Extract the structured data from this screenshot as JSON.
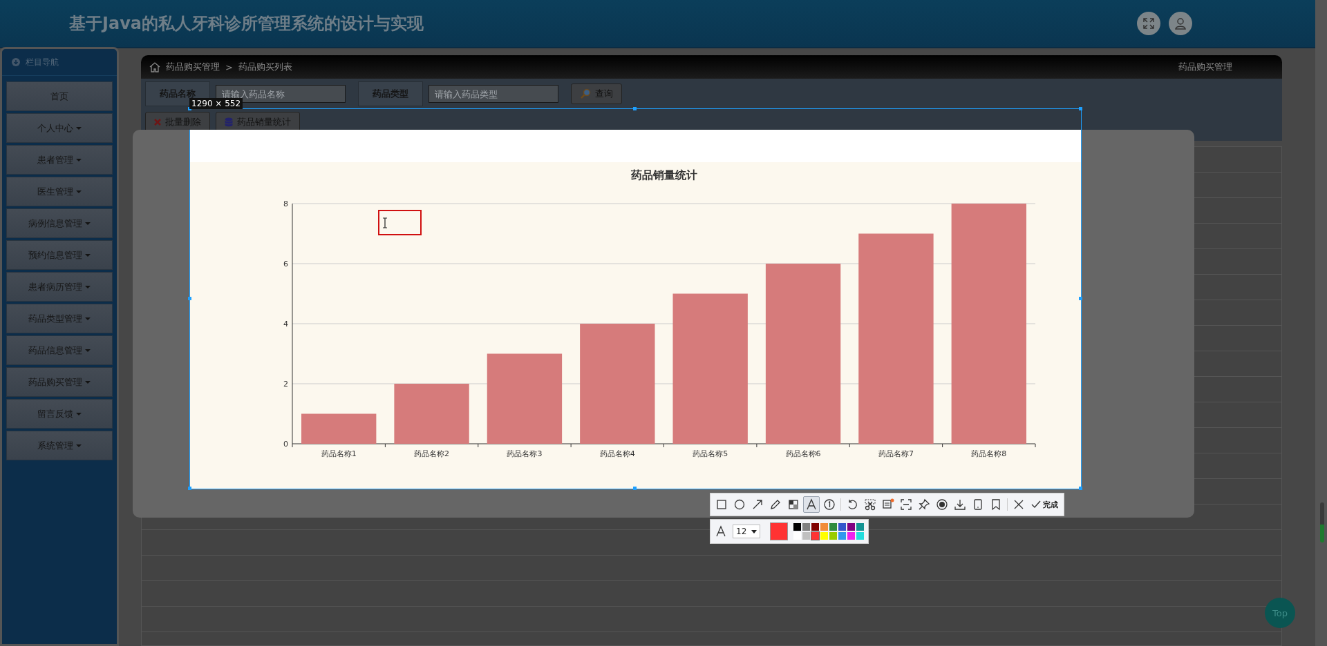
{
  "header": {
    "title": "基于Java的私人牙科诊所管理系统的设计与实现"
  },
  "sidebar": {
    "title": "栏目导航",
    "items": [
      {
        "label": "首页",
        "has_menu": false
      },
      {
        "label": "个人中心",
        "has_menu": true
      },
      {
        "label": "患者管理",
        "has_menu": true
      },
      {
        "label": "医生管理",
        "has_menu": true
      },
      {
        "label": "病例信息管理",
        "has_menu": true
      },
      {
        "label": "预约信息管理",
        "has_menu": true
      },
      {
        "label": "患者病历管理",
        "has_menu": true
      },
      {
        "label": "药品类型管理",
        "has_menu": true
      },
      {
        "label": "药品信息管理",
        "has_menu": true
      },
      {
        "label": "药品购买管理",
        "has_menu": true
      },
      {
        "label": "留言反馈",
        "has_menu": true
      },
      {
        "label": "系统管理",
        "has_menu": true
      }
    ]
  },
  "breadcrumb": {
    "items": [
      "药品购买管理",
      "药品购买列表"
    ],
    "separator": ">",
    "page_title": "药品购买管理"
  },
  "search": {
    "fields": [
      {
        "label": "药品名称",
        "placeholder": "请输入药品名称"
      },
      {
        "label": "药品类型",
        "placeholder": "请输入药品类型"
      }
    ],
    "button": "查询"
  },
  "actions": [
    {
      "kind": "delete",
      "label": "批量删除"
    },
    {
      "kind": "stats",
      "label": "药品销量统计"
    }
  ],
  "capture": {
    "size": "1290 × 552",
    "chart_data": {
      "type": "bar",
      "title": "药品销量统计",
      "categories": [
        "药品名称1",
        "药品名称2",
        "药品名称3",
        "药品名称4",
        "药品名称5",
        "药品名称6",
        "药品名称7",
        "药品名称8"
      ],
      "series": [
        {
          "color": "#d67b7b",
          "values": [
            1,
            2,
            3,
            4,
            5,
            6,
            7,
            8
          ]
        }
      ],
      "ylim": [
        0,
        8
      ],
      "yticks": [
        0,
        2,
        4,
        6,
        8
      ],
      "grid": true
    }
  },
  "capture_toolbar": {
    "tool_groups": [
      {
        "tools": [
          {
            "kind": "rectangle",
            "selected": false
          },
          {
            "kind": "ellipse",
            "selected": false
          },
          {
            "kind": "arrow",
            "selected": false
          },
          {
            "kind": "pencil",
            "selected": false
          },
          {
            "kind": "mosaic",
            "selected": false
          },
          {
            "kind": "text",
            "selected": true
          },
          {
            "kind": "number",
            "selected": false
          }
        ]
      },
      {
        "tools": [
          {
            "kind": "undo",
            "selected": false
          },
          {
            "kind": "scissors",
            "selected": false
          },
          {
            "kind": "image",
            "selected": false
          },
          {
            "kind": "scan",
            "selected": false
          },
          {
            "kind": "pin",
            "selected": false
          },
          {
            "kind": "record",
            "selected": false
          },
          {
            "kind": "download",
            "selected": false
          },
          {
            "kind": "phone",
            "selected": false
          },
          {
            "kind": "bookmark",
            "selected": false
          }
        ]
      },
      {
        "tools": [
          {
            "kind": "close",
            "selected": false
          }
        ]
      }
    ],
    "done": "完成",
    "font_size": "12",
    "palette": [
      {
        "color": "#000000",
        "selected": false
      },
      {
        "color": "#808080",
        "selected": false
      },
      {
        "color": "#800000",
        "selected": false
      },
      {
        "color": "#f28c38",
        "selected": false
      },
      {
        "color": "#2e8b3e",
        "selected": false
      },
      {
        "color": "#3355cc",
        "selected": false
      },
      {
        "color": "#800080",
        "selected": false
      },
      {
        "color": "#139393",
        "selected": false
      },
      {
        "color": "#ffffff",
        "selected": false
      },
      {
        "color": "#c0c0c0",
        "selected": false
      },
      {
        "color": "#ff3333",
        "selected": true
      },
      {
        "color": "#ffff00",
        "selected": false
      },
      {
        "color": "#99cc00",
        "selected": false
      },
      {
        "color": "#3399ee",
        "selected": false
      },
      {
        "color": "#ee22ee",
        "selected": false
      },
      {
        "color": "#22dddd",
        "selected": false
      }
    ]
  },
  "back_to_top": "Top"
}
